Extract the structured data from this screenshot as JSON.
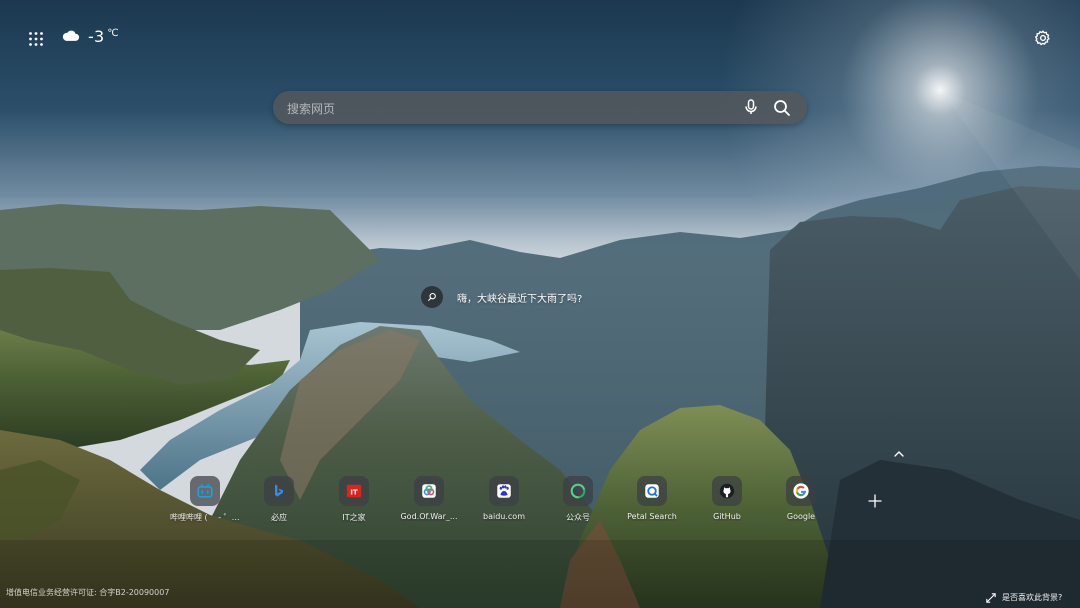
{
  "weather": {
    "icon": "cloud-icon",
    "temperature": "-3",
    "unit": "℃"
  },
  "search": {
    "placeholder": "搜索网页",
    "value": ""
  },
  "hint": {
    "text": "嗨，大峡谷最近下大雨了吗?"
  },
  "shortcuts": [
    {
      "label": "哔哩哔哩 ( ゜- ゜)つロ 干杯~",
      "icon": "bilibili-icon"
    },
    {
      "label": "必应",
      "icon": "bing-icon"
    },
    {
      "label": "IT之家",
      "icon": "ithome-icon"
    },
    {
      "label": "God.Of.War_...",
      "icon": "godofwar-icon"
    },
    {
      "label": "baidu.com",
      "icon": "baidu-icon"
    },
    {
      "label": "公众号",
      "icon": "wechat-mp-icon"
    },
    {
      "label": "Petal Search",
      "icon": "petal-search-icon"
    },
    {
      "label": "GitHub",
      "icon": "github-icon"
    },
    {
      "label": "Google",
      "icon": "google-icon"
    }
  ],
  "footer": {
    "license": "增值电信业务经营许可证: 合字B2-20090007",
    "favorite_prompt": "是否喜欢此背景?"
  },
  "colors": {
    "sky_top": "#1d3a52",
    "sky_horizon": "#c9d3da",
    "search_bg": "#55585c",
    "bilibili": "#20a0d8",
    "ithome": "#d9251d",
    "baidu": "#2932e1",
    "wechat": "#2aae67"
  }
}
